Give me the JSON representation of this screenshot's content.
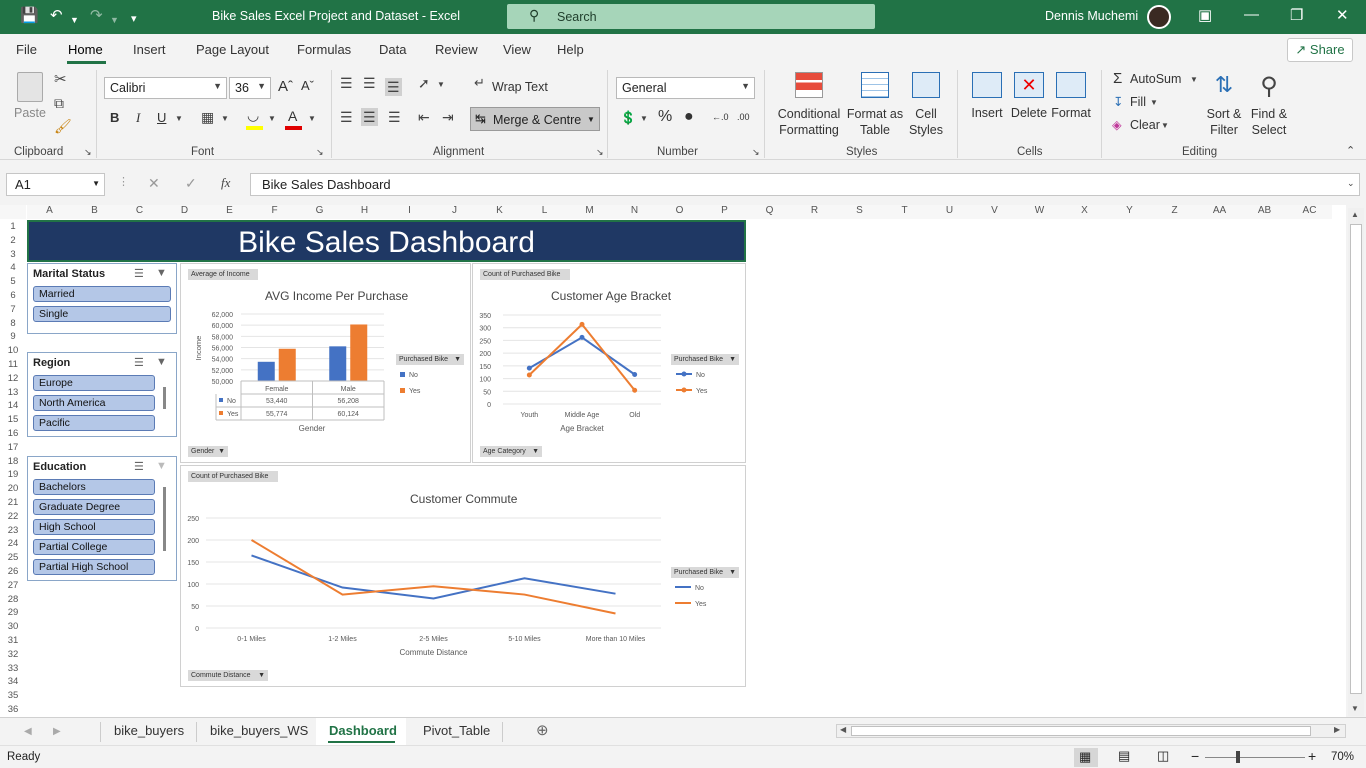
{
  "titlebar": {
    "doc_title": "Bike Sales Excel Project and Dataset  -  Excel",
    "search_placeholder": "Search",
    "user": "Dennis Muchemi"
  },
  "menu_tabs": [
    "File",
    "Home",
    "Insert",
    "Page Layout",
    "Formulas",
    "Data",
    "Review",
    "View",
    "Help"
  ],
  "share_label": "Share",
  "ribbon": {
    "paste": "Paste",
    "font_name": "Calibri",
    "font_size": "36",
    "bold": "B",
    "italic": "I",
    "underline": "U",
    "wrap_text": "Wrap Text",
    "merge_centre": "Merge & Centre",
    "number_format": "General",
    "conditional_formatting": "Conditional Formatting",
    "format_as_table": "Format as Table",
    "cell_styles": "Cell Styles",
    "insert": "Insert",
    "delete": "Delete",
    "format": "Format",
    "autosum": "AutoSum",
    "fill": "Fill",
    "clear": "Clear",
    "sort_filter": "Sort & Filter",
    "find_select": "Find & Select",
    "groups": [
      "Clipboard",
      "Font",
      "Alignment",
      "Number",
      "Styles",
      "Cells",
      "Editing"
    ]
  },
  "formula_bar": {
    "cell_ref": "A1",
    "fx": "fx",
    "content": "Bike Sales Dashboard"
  },
  "columns": [
    "A",
    "B",
    "C",
    "D",
    "E",
    "F",
    "G",
    "H",
    "I",
    "J",
    "K",
    "L",
    "M",
    "N",
    "O",
    "P",
    "Q",
    "R",
    "S",
    "T",
    "U",
    "V",
    "W",
    "X",
    "Y",
    "Z",
    "AA",
    "AB",
    "AC"
  ],
  "rows": [
    "1",
    "2",
    "3",
    "4",
    "5",
    "6",
    "7",
    "8",
    "9",
    "10",
    "11",
    "12",
    "13",
    "14",
    "15",
    "16",
    "17",
    "18",
    "19",
    "20",
    "21",
    "22",
    "23",
    "24",
    "25",
    "26",
    "27",
    "28",
    "29",
    "30",
    "31",
    "32",
    "33",
    "34",
    "35",
    "36"
  ],
  "dashboard_title": "Bike Sales Dashboard",
  "slicers": {
    "marital": {
      "title": "Marital Status",
      "items": [
        "Married",
        "Single"
      ]
    },
    "region": {
      "title": "Region",
      "items": [
        "Europe",
        "North America",
        "Pacific"
      ]
    },
    "education": {
      "title": "Education",
      "items": [
        "Bachelors",
        "Graduate Degree",
        "High School",
        "Partial College",
        "Partial High School"
      ]
    }
  },
  "chart_data": [
    {
      "type": "bar",
      "title": "AVG Income Per Purchase",
      "value_field_button": "Average of Income",
      "axis_field_button": "Gender",
      "legend_field_button": "Purchased Bike",
      "xlabel": "Gender",
      "ylabel": "Income",
      "categories": [
        "Female",
        "Male"
      ],
      "series": [
        {
          "name": "No",
          "values": [
            53440,
            56208
          ],
          "labels": [
            "53,440",
            "56,208"
          ],
          "color": "#4472c4"
        },
        {
          "name": "Yes",
          "values": [
            55774,
            60124
          ],
          "labels": [
            "55,774",
            "60,124"
          ],
          "color": "#ed7d31"
        }
      ],
      "ylim": [
        50000,
        62000
      ],
      "yticks": [
        "62,000",
        "60,000",
        "58,000",
        "56,000",
        "54,000",
        "52,000",
        "50,000"
      ],
      "data_table": true
    },
    {
      "type": "line",
      "title": "Customer Age Bracket",
      "value_field_button": "Count of Purchased Bike",
      "axis_field_button": "Age Category",
      "legend_field_button": "Purchased Bike",
      "xlabel": "Age Bracket",
      "categories": [
        "Youth",
        "Middle Age",
        "Old"
      ],
      "series": [
        {
          "name": "No",
          "values": [
            141,
            262,
            116
          ],
          "color": "#4472c4"
        },
        {
          "name": "Yes",
          "values": [
            114,
            313,
            54
          ],
          "color": "#ed7d31"
        }
      ],
      "ylim": [
        0,
        350
      ],
      "yticks": [
        "350",
        "300",
        "250",
        "200",
        "150",
        "100",
        "50",
        "0"
      ]
    },
    {
      "type": "line",
      "title": "Customer Commute",
      "value_field_button": "Count of Purchased Bike",
      "axis_field_button": "Commute Distance",
      "legend_field_button": "Purchased Bike",
      "xlabel": "Commute Distance",
      "categories": [
        "0-1 Miles",
        "1-2 Miles",
        "2-5 Miles",
        "5-10 Miles",
        "More than 10 Miles"
      ],
      "series": [
        {
          "name": "No",
          "values": [
            165,
            92,
            67,
            113,
            78
          ],
          "color": "#4472c4"
        },
        {
          "name": "Yes",
          "values": [
            200,
            76,
            95,
            76,
            33
          ],
          "color": "#ed7d31"
        }
      ],
      "ylim": [
        0,
        250
      ],
      "yticks": [
        "250",
        "200",
        "150",
        "100",
        "50",
        "0"
      ]
    }
  ],
  "sheet_tabs": [
    "bike_buyers",
    "bike_buyers_WS",
    "Dashboard",
    "Pivot_Table"
  ],
  "active_sheet": "Dashboard",
  "status": {
    "left": "Ready",
    "zoom": "70%"
  }
}
